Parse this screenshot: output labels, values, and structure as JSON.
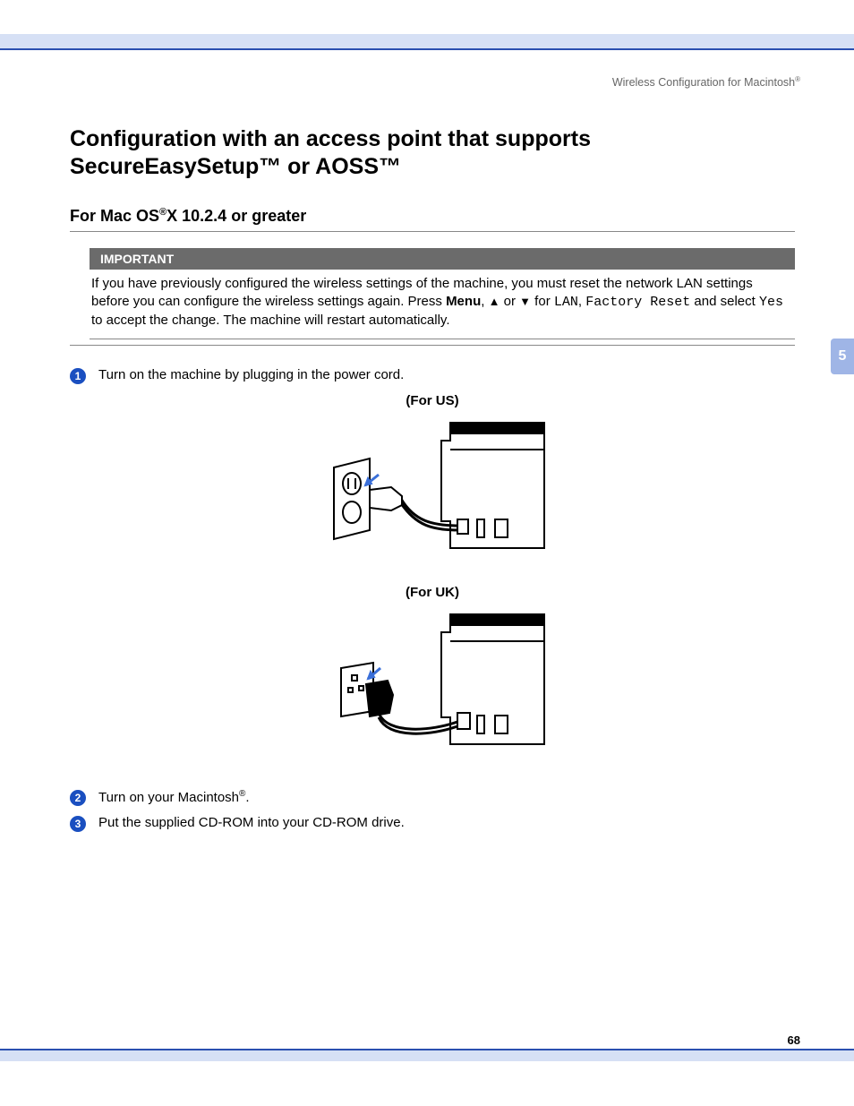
{
  "header": {
    "running_head": "Wireless Configuration for Macintosh",
    "running_head_sup": "®"
  },
  "title": "Configuration with an access point that supports SecureEasySetup™ or AOSS™",
  "subtitle_pre": "For Mac OS",
  "subtitle_sup": "®",
  "subtitle_post": "X 10.2.4 or greater",
  "important": {
    "label": "IMPORTANT",
    "body_pre": "If you have previously configured the wireless settings of the machine, you must reset the network LAN settings before you can configure the wireless settings again. Press ",
    "menu": "Menu",
    "sep1": ", ",
    "arrow_up": "▲",
    "or": " or ",
    "arrow_down": "▼",
    "for": " for ",
    "lan": "LAN",
    "sep2": ", ",
    "factory_reset": "Factory Reset",
    "and_select": " and select ",
    "yes": "Yes",
    "body_post": " to accept the change. The machine will restart automatically."
  },
  "steps": {
    "s1": {
      "num": "1",
      "text": "Turn on the machine by plugging in the power cord."
    },
    "s2": {
      "num": "2",
      "text_pre": "Turn on your Macintosh",
      "sup": "®",
      "text_post": "."
    },
    "s3": {
      "num": "3",
      "text": "Put the supplied CD-ROM into your CD-ROM drive."
    }
  },
  "figures": {
    "us": "(For US)",
    "uk": "(For UK)"
  },
  "chapter_tab": "5",
  "page_number": "68"
}
